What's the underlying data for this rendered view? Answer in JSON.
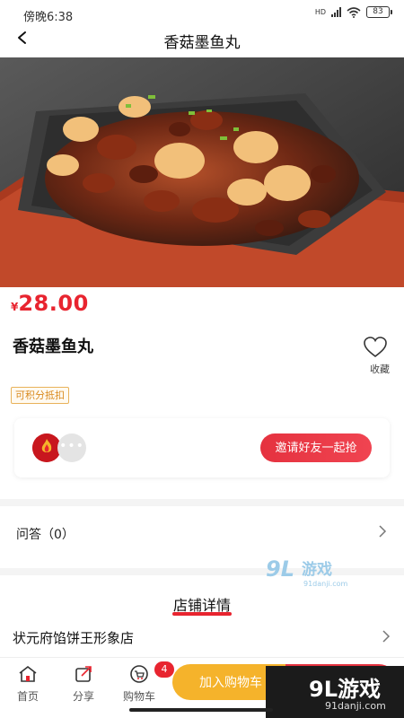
{
  "status_bar": {
    "time": "傍晚6:38",
    "network": "HD",
    "battery": "83"
  },
  "nav": {
    "title": "香菇墨鱼丸"
  },
  "product": {
    "price_symbol": "¥",
    "price": "28.00",
    "name": "香菇墨鱼丸",
    "favorite_label": "收藏",
    "points_tag": "可积分抵扣"
  },
  "invite": {
    "more": "•••",
    "button_label": "邀请好友一起抢"
  },
  "qa": {
    "label": "问答（0）"
  },
  "shop": {
    "section_title": "店铺详情",
    "name": "状元府馅饼王形象店"
  },
  "bottom_bar": {
    "tabs": [
      {
        "label": "首页",
        "icon": "home-icon"
      },
      {
        "label": "分享",
        "icon": "share-icon"
      },
      {
        "label": "购物车",
        "icon": "cart-icon"
      }
    ],
    "cart_badge": "4",
    "add_to_cart_label": "加入购物车"
  },
  "watermark": {
    "logo": "9L游戏",
    "site": "91danji.com"
  },
  "colors": {
    "accent_red": "#e8242f",
    "cart_orange": "#f5b32b",
    "tag_orange": "#d98a1e"
  }
}
